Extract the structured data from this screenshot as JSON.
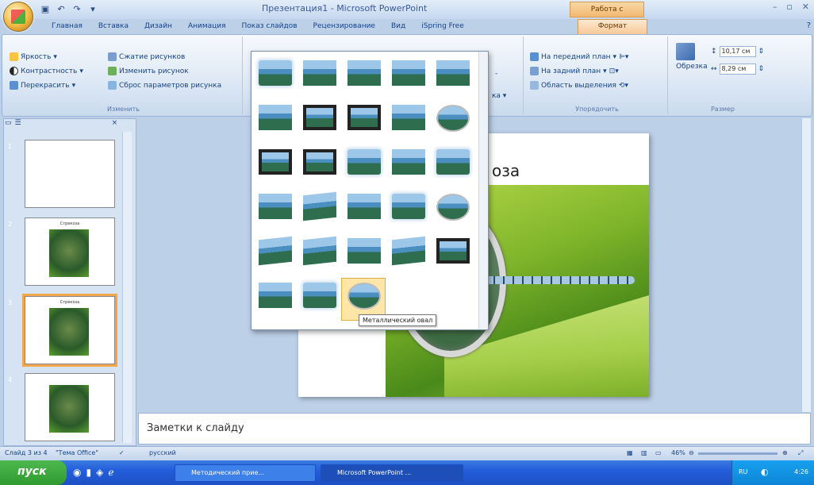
{
  "app": {
    "title": "Презентация1 - Microsoft PowerPoint",
    "context_group": "Работа с рисунками"
  },
  "tabs": [
    "Главная",
    "Вставка",
    "Дизайн",
    "Анимация",
    "Показ слайдов",
    "Рецензирование",
    "Вид",
    "iSpring Free"
  ],
  "context_tab": "Формат",
  "ribbon": {
    "adjust": {
      "brightness": "Яркость",
      "contrast": "Контрастность",
      "recolor": "Перекрасить",
      "compress": "Сжатие рисунков",
      "change": "Изменить рисунок",
      "reset": "Сброс параметров рисунка",
      "title": "Изменить"
    },
    "arrange": {
      "front": "На передний план",
      "back": "На задний план",
      "selection": "Область выделения",
      "title": "Упорядочить"
    },
    "size": {
      "crop": "Обрезка",
      "height": "10,17 см",
      "width": "8,29 см",
      "title": "Размер"
    }
  },
  "gallery": {
    "tooltip": "Металлический овал"
  },
  "slides": [
    {
      "num": "1"
    },
    {
      "num": "2",
      "title": "Стрекоза"
    },
    {
      "num": "3",
      "title": "Стрекоза"
    },
    {
      "num": "4"
    }
  ],
  "slide": {
    "title_fragment": "оза"
  },
  "notes": {
    "placeholder": "Заметки к слайду"
  },
  "status": {
    "slide": "Слайд 3 из 4",
    "theme": "\"Тема Office\"",
    "lang": "русский",
    "zoom": "46%"
  },
  "taskbar": {
    "start": "пуск",
    "task1": "Методический прие...",
    "task2": "Microsoft PowerPoint ...",
    "lang": "RU",
    "time": "4:26"
  }
}
